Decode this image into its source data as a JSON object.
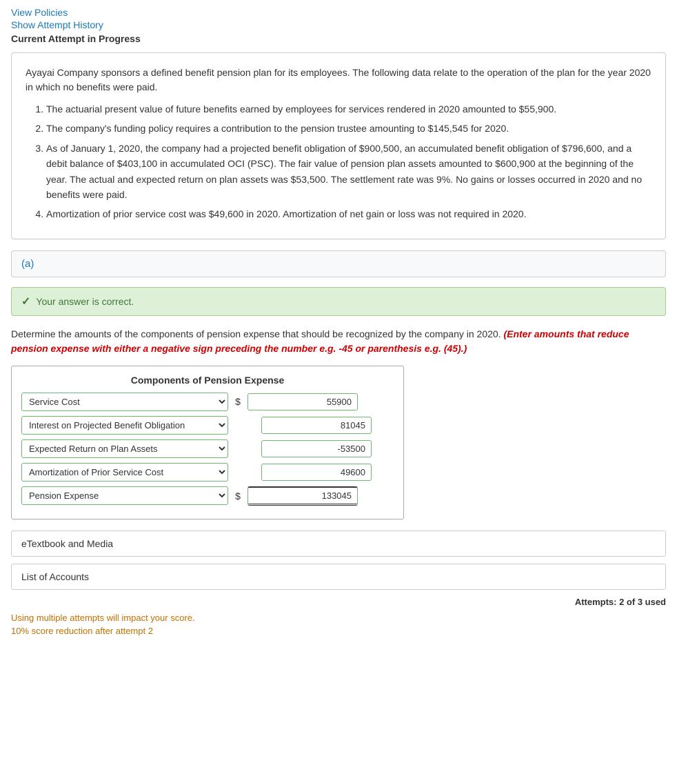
{
  "topLinks": {
    "viewPolicies": "View Policies",
    "showAttemptHistory": "Show Attempt History"
  },
  "currentAttempt": "Current Attempt in Progress",
  "problemText": {
    "intro": "Ayayai Company sponsors a defined benefit pension plan for its employees. The following data relate to the operation of the plan for the year 2020 in which no benefits were paid.",
    "items": [
      "The actuarial present value of future benefits earned by employees for services rendered in 2020 amounted to $55,900.",
      "The company's funding policy requires a contribution to the pension trustee amounting to $145,545 for 2020.",
      "As of January 1, 2020, the company had a projected benefit obligation of $900,500, an accumulated benefit obligation of $796,600, and a debit balance of $403,100 in accumulated OCI (PSC). The fair value of pension plan assets amounted to $600,900 at the beginning of the year. The actual and expected return on plan assets was $53,500. The settlement rate was 9%. No gains or losses occurred in 2020 and no benefits were paid.",
      "Amortization of prior service cost was $49,600 in 2020. Amortization of net gain or loss was not required in 2020."
    ]
  },
  "sectionLabel": "(a)",
  "correctBanner": "Your answer is correct.",
  "instructions": {
    "main": "Determine the amounts of the components of pension expense that should be recognized by the company in 2020.",
    "redItalic": "(Enter amounts that reduce pension expense with either a negative sign preceding the number e.g. -45 or parenthesis e.g. (45).)"
  },
  "pensionTable": {
    "title": "Components of Pension Expense",
    "rows": [
      {
        "label": "Service Cost",
        "dollarSign": "$",
        "value": "55900",
        "showDollar": true
      },
      {
        "label": "Interest on Projected Benefit Obligation",
        "dollarSign": "",
        "value": "81045",
        "showDollar": false
      },
      {
        "label": "Expected Return on Plan Assets",
        "dollarSign": "",
        "value": "-53500",
        "showDollar": false
      },
      {
        "label": "Amortization of Prior Service Cost",
        "dollarSign": "",
        "value": "49600",
        "showDollar": false
      },
      {
        "label": "Pension Expense",
        "dollarSign": "$",
        "value": "133045",
        "showDollar": true,
        "isLast": true
      }
    ]
  },
  "collapsibleSections": [
    "eTextbook and Media",
    "List of Accounts"
  ],
  "attemptsText": "Attempts: 2 of 3 used",
  "scoreWarning": {
    "line1": "Using multiple attempts will impact your score.",
    "line2": "10% score reduction after attempt 2"
  }
}
